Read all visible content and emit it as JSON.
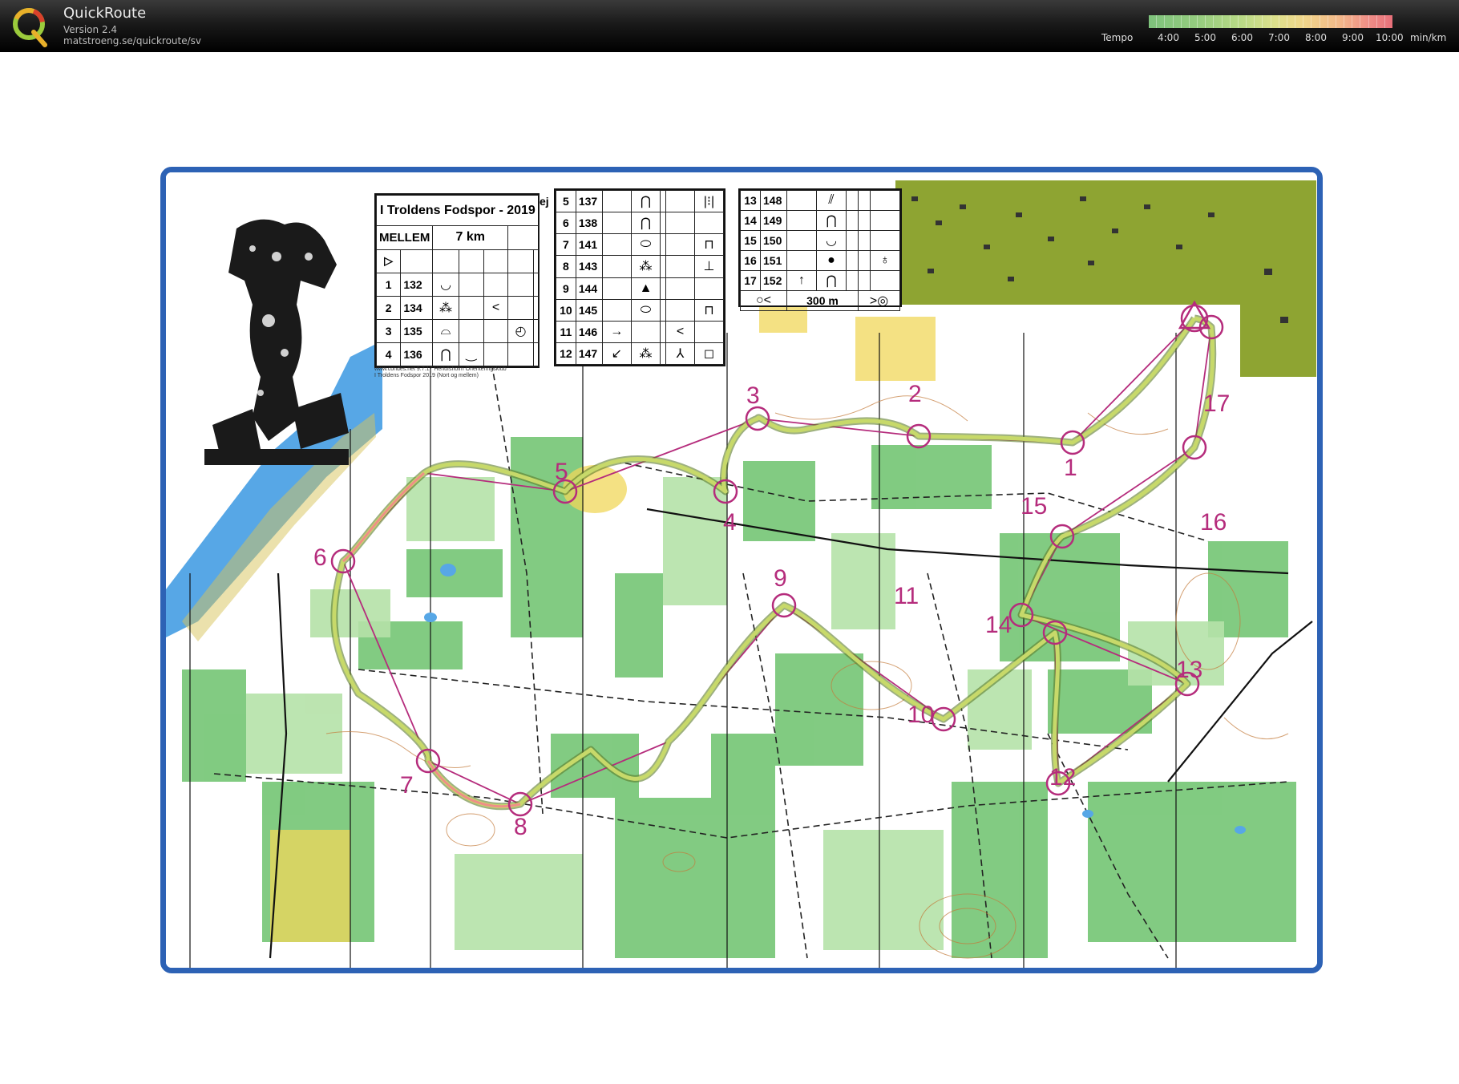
{
  "app": {
    "title": "QuickRoute",
    "version": "Version 2.4",
    "url": "matstroeng.se/quickroute/sv"
  },
  "tempo": {
    "label": "Tempo",
    "ticks": [
      "4:00",
      "5:00",
      "6:00",
      "7:00",
      "8:00",
      "9:00",
      "10:00"
    ],
    "unit": "min/km",
    "colors": [
      "#7ec27c",
      "#b9da86",
      "#f0d58a",
      "#f3b98a",
      "#e8707a"
    ]
  },
  "map": {
    "frame_color": "#2d62b5",
    "control_color": "#b52c7c",
    "route_color": "#9acb53",
    "course_title": "I Troldens Fodspor - 2019",
    "class": "MELLEM",
    "length": "7 km",
    "ej": "ej",
    "finish_distance": "300 m",
    "footer_line1": "www.condes.net 9.7.17 Herlufsholm Orienteringsklub",
    "footer_line2": "I Troldens Fodspor 2019 (Nort og mellem)",
    "descriptions": [
      {
        "n": "1",
        "code": "132",
        "sym": "◡"
      },
      {
        "n": "2",
        "code": "134",
        "sym": "⁂",
        "sym2": "<"
      },
      {
        "n": "3",
        "code": "135",
        "sym": "⌓",
        "sym2": "◴"
      },
      {
        "n": "4",
        "code": "136",
        "sym": "⋂",
        "sym2": "‿"
      },
      {
        "n": "5",
        "code": "137",
        "sym": "⋂",
        "sym2": "|⁝|"
      },
      {
        "n": "6",
        "code": "138",
        "sym": "⋂"
      },
      {
        "n": "7",
        "code": "141",
        "sym": "⬭",
        "sym2": "⊓"
      },
      {
        "n": "8",
        "code": "143",
        "sym": "⁂",
        "sym2": "⊥"
      },
      {
        "n": "9",
        "code": "144",
        "sym": "▲"
      },
      {
        "n": "10",
        "code": "145",
        "sym": "⬭",
        "sym2": "⊓"
      },
      {
        "n": "11",
        "code": "146",
        "sym": "→",
        "sym2": "<"
      },
      {
        "n": "12",
        "code": "147",
        "sym": "↙",
        "sym2": "⁂",
        "sym3": "⅄",
        "sym4": "◻"
      },
      {
        "n": "13",
        "code": "148",
        "sym": "⫽"
      },
      {
        "n": "14",
        "code": "149",
        "sym": "⋂"
      },
      {
        "n": "15",
        "code": "150",
        "sym": "◡"
      },
      {
        "n": "16",
        "code": "151",
        "sym": "●",
        "sym2": "♁"
      },
      {
        "n": "17",
        "code": "152",
        "sym": "↑",
        "sym2": "⋂"
      }
    ],
    "control_labels": [
      "1",
      "2",
      "3",
      "4",
      "5",
      "6",
      "7",
      "8",
      "9",
      "10",
      "11",
      "12",
      "13",
      "14",
      "15",
      "16",
      "17"
    ]
  }
}
